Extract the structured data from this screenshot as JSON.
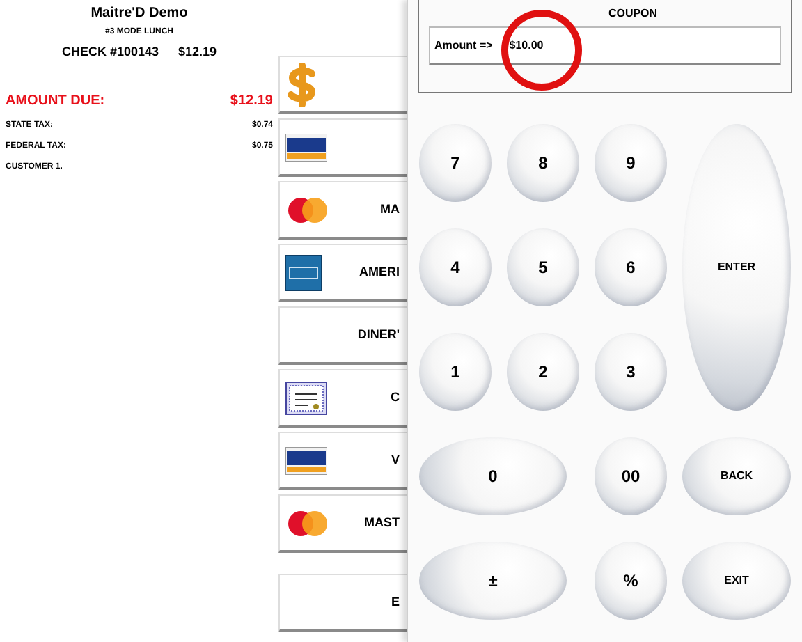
{
  "receipt": {
    "title": "Maitre'D Demo",
    "mode": "#3  MODE LUNCH",
    "check": "CHECK #100143",
    "check_total": "$12.19",
    "amount_due": {
      "label": "AMOUNT DUE:",
      "value": "$12.19"
    },
    "lines": [
      {
        "label": "STATE TAX:",
        "value": "$0.74"
      },
      {
        "label": "FEDERAL TAX:",
        "value": "$0.75"
      },
      {
        "label": "CUSTOMER 1."
      }
    ]
  },
  "payment_buttons": [
    {
      "kind": "cash"
    },
    {
      "kind": "visa"
    },
    {
      "kind": "mastercard",
      "label": "MA"
    },
    {
      "kind": "amex",
      "label": "AMERI"
    },
    {
      "kind": "plain",
      "label": "DINER'"
    },
    {
      "kind": "certificate",
      "label": "C"
    },
    {
      "kind": "visa",
      "label": "V"
    },
    {
      "kind": "mastercard",
      "label": "MAST"
    },
    {
      "kind": "plain",
      "label": "E",
      "gap": true
    }
  ],
  "dialog": {
    "title": "COUPON",
    "amount_label": "Amount  =>",
    "amount_value": "$10.00",
    "keys": [
      {
        "label": "7",
        "kind": "round"
      },
      {
        "label": "8",
        "kind": "round"
      },
      {
        "label": "9",
        "kind": "round"
      },
      {
        "label": "4",
        "kind": "round"
      },
      {
        "label": "5",
        "kind": "round"
      },
      {
        "label": "6",
        "kind": "round"
      },
      {
        "label": "1",
        "kind": "round"
      },
      {
        "label": "2",
        "kind": "round"
      },
      {
        "label": "3",
        "kind": "round"
      },
      {
        "label": "0",
        "kind": "wide"
      },
      {
        "label": "00",
        "kind": "round"
      },
      {
        "label": "±",
        "kind": "wide"
      },
      {
        "label": "%",
        "kind": "round"
      }
    ],
    "side_keys": [
      {
        "label": "ENTER",
        "kind": "tall"
      },
      {
        "label": "BACK",
        "kind": "side"
      },
      {
        "label": "EXIT",
        "kind": "side"
      }
    ]
  }
}
